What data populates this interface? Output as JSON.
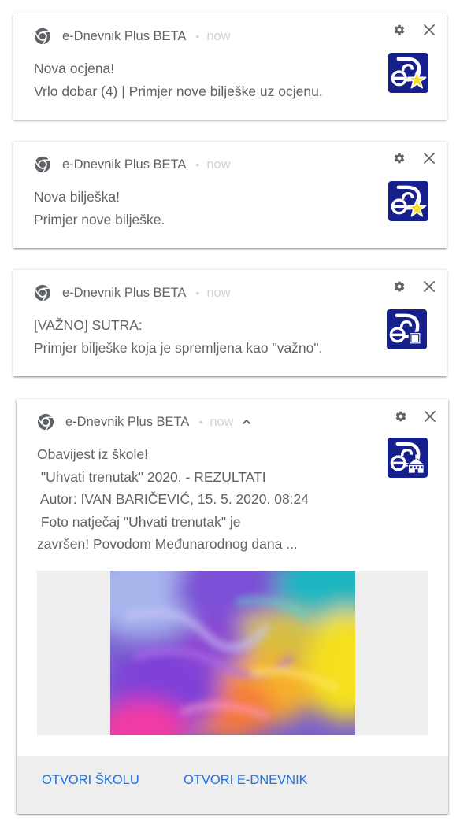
{
  "notifications": [
    {
      "app_name": "e-Dnevnik Plus BETA",
      "time": "now",
      "title": "Nova ocjena!",
      "lines": [
        "Vrlo dobar (4) | Primjer nove bilješke uz ocjenu."
      ],
      "logo_icon": "edn-star-logo"
    },
    {
      "app_name": "e-Dnevnik Plus BETA",
      "time": "now",
      "title": "Nova bilješka!",
      "lines": [
        "Primjer nove bilješke."
      ],
      "logo_icon": "edn-star-logo"
    },
    {
      "app_name": "e-Dnevnik Plus BETA",
      "time": "now",
      "title": "[VAŽNO] SUTRA:",
      "lines": [
        "Primjer bilješke koja je spremljena kao \"važno\"."
      ],
      "logo_icon": "edn-square-logo"
    },
    {
      "app_name": "e-Dnevnik Plus BETA",
      "time": "now",
      "title": "Obavijest iz škole!",
      "lines": [
        " \"Uhvati trenutak\" 2020. - REZULTATI",
        " Autor: IVAN BARIČEVIĆ, 15. 5. 2020. 08:24",
        " Foto natječaj \"Uhvati trenutak\" je",
        "završen! Povodom Međunarodnog dana ..."
      ],
      "logo_icon": "edn-school-logo",
      "image": "colorful-paint-photo",
      "actions": [
        "OTVORI ŠKOLU",
        "OTVORI E-DNEVNIK"
      ]
    }
  ],
  "colors": {
    "logo_navy": "#16208c",
    "action_blue": "#1a73e8",
    "text_gray": "#5f6368",
    "star_yellow": "#f6e12e"
  }
}
